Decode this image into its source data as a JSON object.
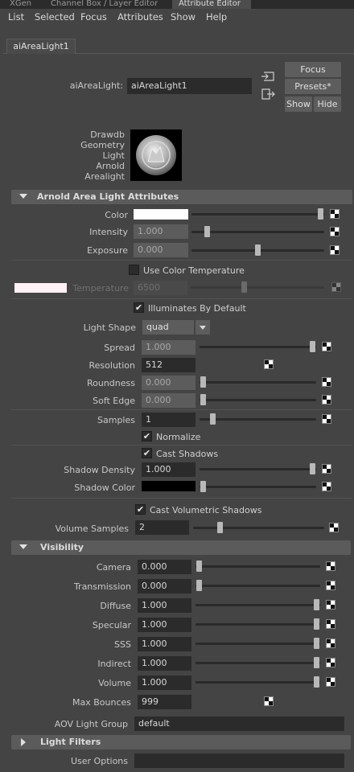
{
  "tabs": [
    "XGen",
    "Channel Box / Layer Editor",
    "Attribute Editor"
  ],
  "menu": [
    "List",
    "Selected",
    "Focus",
    "Attributes",
    "Show",
    "Help"
  ],
  "node_tab": "aiAreaLight1",
  "header": {
    "label": "aiAreaLight:",
    "value": "aiAreaLight1",
    "focus": "Focus",
    "presets": "Presets*",
    "show": "Show",
    "hide": "Hide"
  },
  "drawdb": [
    "Drawdb",
    "Geometry",
    "Light",
    "Arnold",
    "Arealight"
  ],
  "sections": {
    "attrs": "Arnold Area Light Attributes",
    "visibility": "Visibility",
    "filters": "Light Filters"
  },
  "attrs": {
    "color": "Color",
    "intensity": "Intensity",
    "intensity_val": "1.000",
    "exposure": "Exposure",
    "exposure_val": "0.000",
    "use_color_temp": "Use Color Temperature",
    "temperature": "Temperature",
    "temperature_val": "6500",
    "illuminates": "Illuminates By Default",
    "light_shape": "Light Shape",
    "light_shape_val": "quad",
    "spread": "Spread",
    "spread_val": "1.000",
    "resolution": "Resolution",
    "resolution_val": "512",
    "roundness": "Roundness",
    "roundness_val": "0.000",
    "soft_edge": "Soft Edge",
    "soft_edge_val": "0.000",
    "samples": "Samples",
    "samples_val": "1",
    "normalize": "Normalize",
    "cast_shadows": "Cast Shadows",
    "shadow_density": "Shadow Density",
    "shadow_density_val": "1.000",
    "shadow_color": "Shadow Color",
    "cast_vol": "Cast Volumetric Shadows",
    "vol_samples": "Volume Samples",
    "vol_samples_val": "2"
  },
  "visibility": {
    "camera": "Camera",
    "camera_val": "0.000",
    "transmission": "Transmission",
    "transmission_val": "0.000",
    "diffuse": "Diffuse",
    "diffuse_val": "1.000",
    "specular": "Specular",
    "specular_val": "1.000",
    "sss": "SSS",
    "sss_val": "1.000",
    "indirect": "Indirect",
    "indirect_val": "1.000",
    "volume": "Volume",
    "volume_val": "1.000",
    "max_bounces": "Max Bounces",
    "max_bounces_val": "999"
  },
  "aov": {
    "label": "AOV Light Group",
    "value": "default"
  },
  "user_options": {
    "label": "User Options",
    "value": ""
  },
  "sliders": {
    "color": 1.0,
    "intensity": 0.05,
    "exposure": 0.5,
    "temperature": 0.45,
    "spread": 1.0,
    "roundness": 0.0,
    "soft_edge": 0.0,
    "samples": 0.1,
    "shadow_density": 1.0,
    "shadow_color": 0.0,
    "vol_samples": 0.15,
    "camera": 0.0,
    "transmission": 0.0,
    "diffuse": 1.0,
    "specular": 1.0,
    "sss": 1.0,
    "indirect": 1.0,
    "volume": 1.0
  },
  "colors": {
    "light_color": "#ffffff",
    "shadow_color": "#000000",
    "temp_swatch": "#fff1f6",
    "section": "#5b5b5b"
  },
  "icons": [
    "select-node-icon",
    "swap-node-icon",
    "map-button-icon",
    "expand-arrow-icon",
    "collapse-arrow-icon",
    "area-light-swatch-icon"
  ]
}
